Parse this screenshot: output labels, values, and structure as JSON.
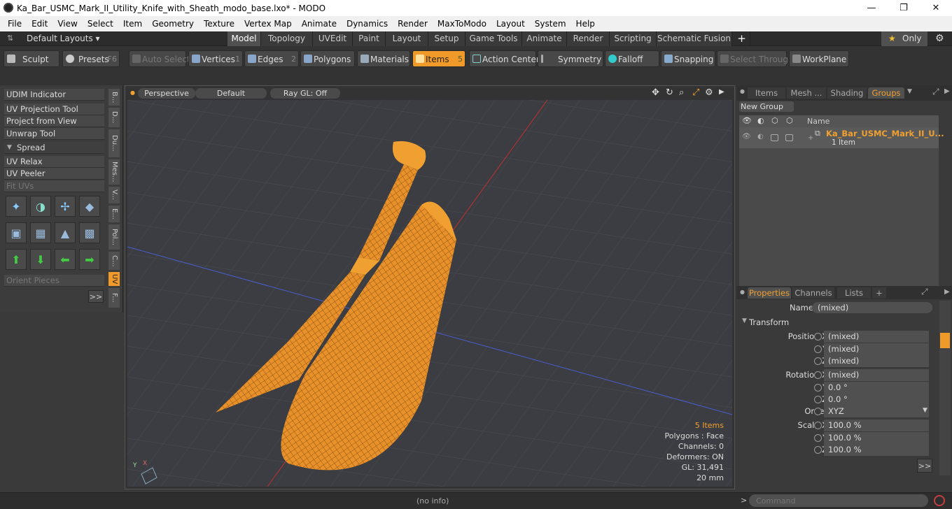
{
  "window": {
    "title": "Ka_Bar_USMC_Mark_II_Utility_Knife_with_Sheath_modo_base.lxo* - MODO",
    "minimize": "—",
    "maximize": "❐",
    "close": "✕"
  },
  "menu": [
    "File",
    "Edit",
    "View",
    "Select",
    "Item",
    "Geometry",
    "Texture",
    "Vertex Map",
    "Animate",
    "Dynamics",
    "Render",
    "MaxToModo",
    "Layout",
    "System",
    "Help"
  ],
  "layoutbar": {
    "layouts_label": "Default Layouts ▾",
    "tabs": [
      "Model",
      "Topology",
      "UVEdit",
      "Paint",
      "Layout",
      "Setup",
      "Game Tools",
      "Animate",
      "Render",
      "Scripting",
      "Schematic Fusion",
      "+"
    ],
    "only": "Only"
  },
  "toolbar": {
    "sculpt": "Sculpt",
    "presets": "Presets",
    "presets_key": "F6",
    "auto_select": "Auto Select",
    "vertices": "Vertices",
    "vertices_key": "1",
    "edges": "Edges",
    "edges_key": "2",
    "polygons": "Polygons",
    "materials": "Materials",
    "items": "Items",
    "items_key": "5",
    "action_center": "Action Center",
    "symmetry": "Symmetry",
    "falloff": "Falloff",
    "snapping": "Snapping",
    "select_through": "Select Through",
    "workplane": "WorkPlane"
  },
  "leftpanel": {
    "buttons": [
      "UDIM Indicator",
      "UV Projection Tool",
      "Project from View",
      "Unwrap Tool",
      "Spread",
      "UV Relax",
      "UV Peeler",
      "Fit UVs"
    ],
    "orient": "Orient Pieces",
    "more": ">>",
    "vtabs": [
      "B...",
      "D...",
      "Du...",
      "Mes...",
      "V...",
      "E...",
      "Pol...",
      "C...",
      "UV",
      "F..."
    ]
  },
  "viewport": {
    "view": "Perspective",
    "shading": "Default",
    "raygl": "Ray GL: Off",
    "info": {
      "items": "5 Items",
      "polygons": "Polygons : Face",
      "channels": "Channels: 0",
      "deformers": "Deformers: ON",
      "gl": "GL: 31,491",
      "scale": "20 mm"
    }
  },
  "groups": {
    "tabs": [
      "Items",
      "Mesh ...",
      "Shading",
      "Groups"
    ],
    "new_group": "New Group",
    "col_name": "Name",
    "item_name": "Ka_Bar_USMC_Mark_II_U...",
    "item_count": "1 Item"
  },
  "properties": {
    "tabs": [
      "Properties",
      "Channels",
      "Lists",
      "+"
    ],
    "name_label": "Name",
    "name_value": "(mixed)",
    "section": "Transform",
    "rows": [
      {
        "label": "Position X",
        "value": "(mixed)"
      },
      {
        "label": "Y",
        "value": "(mixed)"
      },
      {
        "label": "Z",
        "value": "(mixed)"
      },
      {
        "label": "Rotation X",
        "value": "(mixed)"
      },
      {
        "label": "Y",
        "value": "0.0 °"
      },
      {
        "label": "Z",
        "value": "0.0 °"
      },
      {
        "label": "Order",
        "value": "XYZ"
      },
      {
        "label": "Scale X",
        "value": "100.0 %"
      },
      {
        "label": "Y",
        "value": "100.0 %"
      },
      {
        "label": "Z",
        "value": "100.0 %"
      }
    ],
    "more": ">>"
  },
  "status": {
    "info": "(no info)",
    "command_placeholder": "Command"
  },
  "colors": {
    "accent": "#f09a2a",
    "wire": "#f5a020"
  }
}
